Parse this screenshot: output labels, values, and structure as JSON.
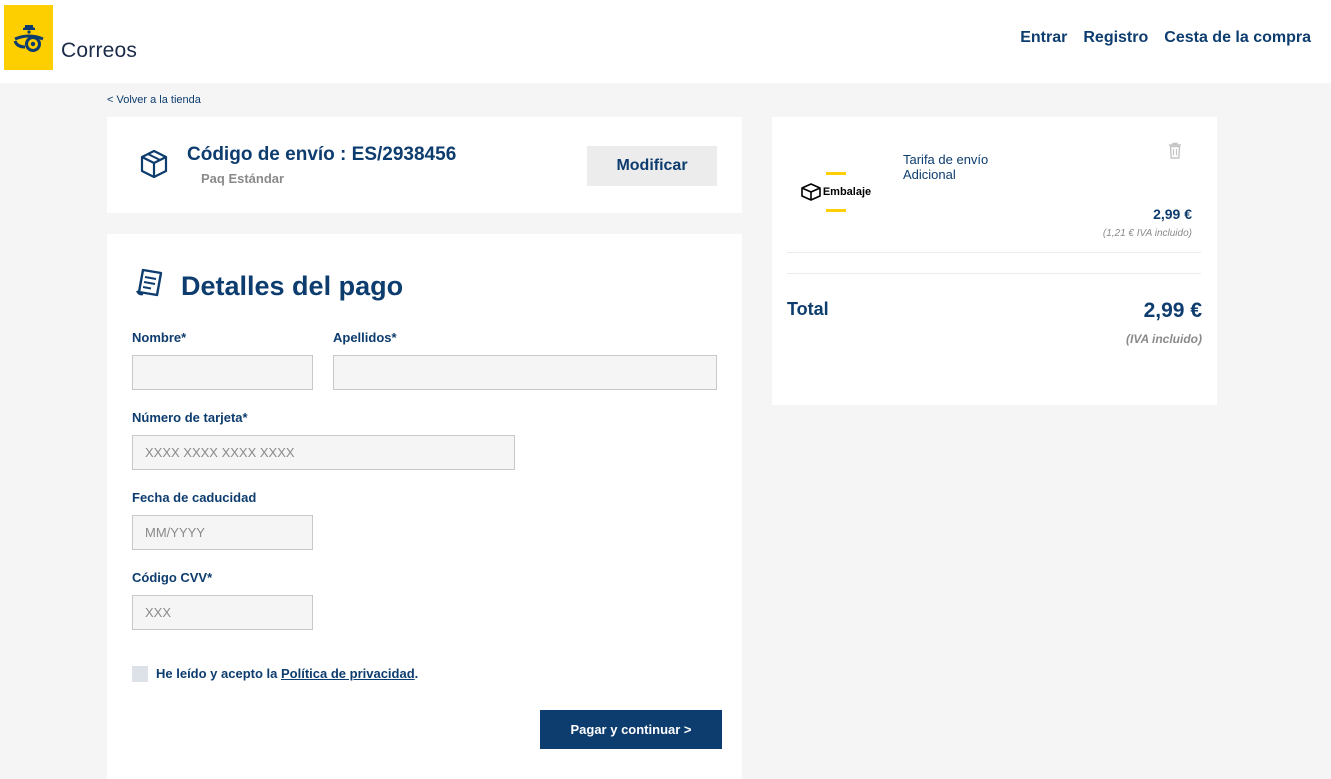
{
  "header": {
    "brand": "Correos",
    "nav": [
      "Entrar",
      "Registro",
      "Cesta de la compra"
    ]
  },
  "back_link": "< Volver a la tienda",
  "shipping": {
    "title": "Código de envío : ES/2938456",
    "subtitle": "Paq Estándar",
    "modify_label": "Modificar"
  },
  "payment": {
    "title": "Detalles del pago",
    "fields": {
      "nombre": {
        "label": "Nombre*",
        "value": "",
        "placeholder": ""
      },
      "apellidos": {
        "label": "Apellidos*",
        "value": "",
        "placeholder": ""
      },
      "tarjeta": {
        "label": "Número de tarjeta*",
        "value": "",
        "placeholder": "XXXX XXXX XXXX XXXX"
      },
      "caducidad": {
        "label": "Fecha de caducidad",
        "value": "",
        "placeholder": "MM/YYYY"
      },
      "cvv": {
        "label": "Código CVV*",
        "value": "",
        "placeholder": "XXX"
      }
    },
    "privacy_prefix": "He leído y acepto la ",
    "privacy_link": "Política de privacidad",
    "privacy_suffix": ".",
    "privacy_checked": false,
    "pay_label": "Pagar y continuar >"
  },
  "summary": {
    "item": {
      "logo_text": "Embalaje",
      "name_line1": "Tarifa de envío",
      "name_line2": "Adicional",
      "price": "2,99 €",
      "iva_note": "(1,21 € IVA incluido)",
      "icon": "trash-icon"
    },
    "total_label": "Total",
    "total_value": "2,99 €",
    "total_iva": "(IVA incluido)"
  },
  "colors": {
    "brand_yellow": "#fdce00",
    "brand_blue": "#0d3c6e",
    "background": "#f5f5f5"
  }
}
